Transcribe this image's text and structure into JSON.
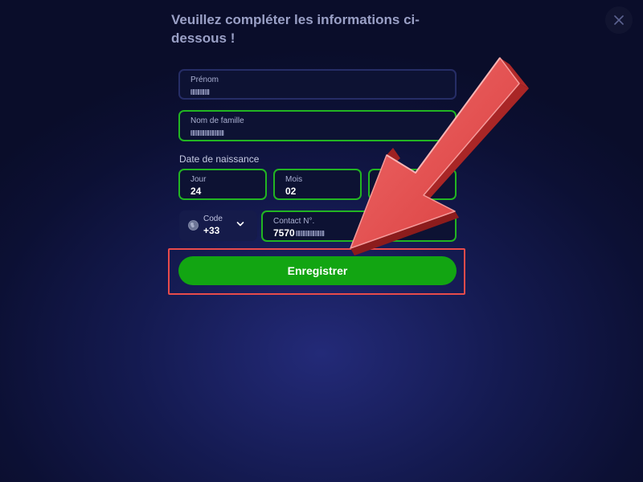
{
  "dialog": {
    "title": "Veuillez compléter les informations ci-dessous !",
    "close_icon": "close-icon"
  },
  "form": {
    "first_name": {
      "label": "Prénom",
      "value_masked": true
    },
    "last_name": {
      "label": "Nom de famille",
      "value_masked": true
    },
    "birth_date": {
      "section_label": "Date de naissance",
      "day": {
        "label": "Jour",
        "value": "24"
      },
      "month": {
        "label": "Mois",
        "value": "02"
      },
      "year": {
        "label": "",
        "value": ""
      }
    },
    "phone": {
      "code_label": "Code",
      "code_value": "+33",
      "country_icon": "globe-icon",
      "dropdown_icon": "chevron-down-icon",
      "contact_label": "Contact N°.",
      "contact_value": "7570"
    },
    "submit_label": "Enregistrer"
  },
  "annotation": {
    "arrow_icon": "red-arrow-icon",
    "highlight_color": "#e84b4b"
  },
  "colors": {
    "accent_green": "#12a512",
    "field_border_valid": "#22b522",
    "field_border_default": "#262d66",
    "annotation_red": "#e84b4b"
  }
}
